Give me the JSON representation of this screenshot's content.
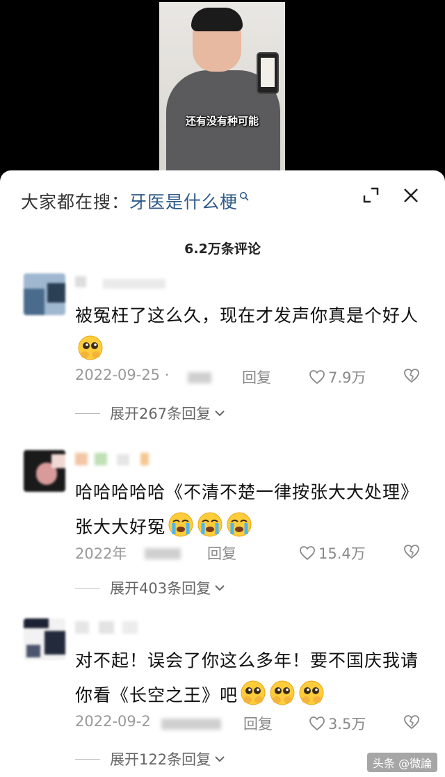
{
  "video": {
    "caption": "还有没有种可能"
  },
  "sheet": {
    "search_prefix": "大家都在搜：",
    "search_term": "牙医是什么梗",
    "comment_count": "6.2万条评论"
  },
  "comments": [
    {
      "text": "被冤枉了这么久，现在才发声你真是个好人",
      "date": "2022-09-25 ·",
      "reply": "回复",
      "likes": "7.9万",
      "expand": "展开267条回复"
    },
    {
      "text": "哈哈哈哈哈《不清不楚一律按张大大处理》 张大大好冤",
      "date": "2022年",
      "reply": "回复",
      "likes": "15.4万",
      "expand": "展开403条回复"
    },
    {
      "text": "对不起！误会了你这么多年！要不国庆我请你看《长空之王》吧",
      "date": "2022-09-2",
      "reply": "回复",
      "likes": "3.5万",
      "expand": "展开122条回复"
    }
  ],
  "watermark": "头条 @微論"
}
